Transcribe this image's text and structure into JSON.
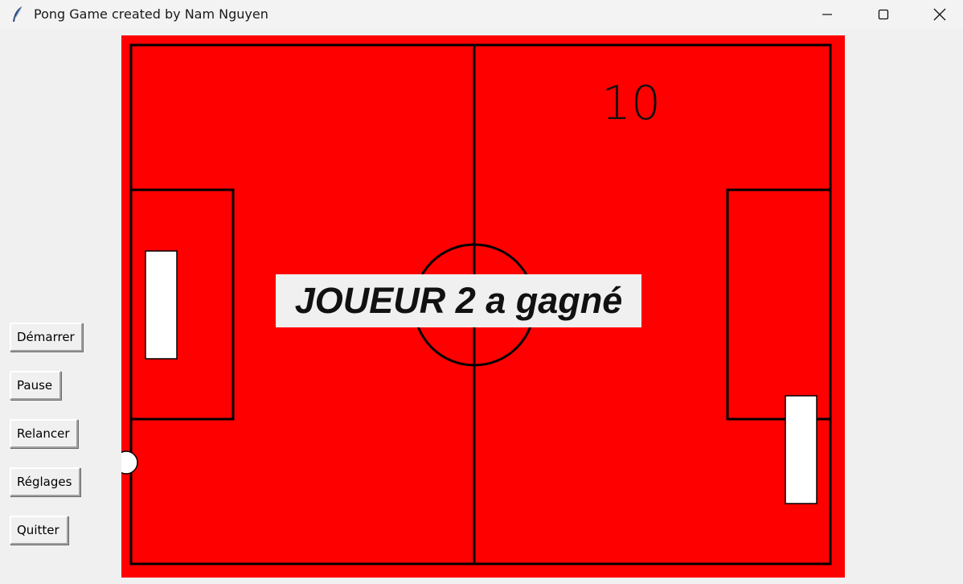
{
  "window": {
    "title": "Pong Game created by Nam Nguyen",
    "app_icon": "feather-icon",
    "controls": [
      "minimize-icon",
      "maximize-icon",
      "close-icon"
    ]
  },
  "sidebar": {
    "buttons": [
      {
        "label": "Démarrer"
      },
      {
        "label": "Pause"
      },
      {
        "label": "Relancer"
      },
      {
        "label": "Réglages"
      },
      {
        "label": "Quitter"
      }
    ]
  },
  "game": {
    "field_color": "#ff0000",
    "line_color": "#000000",
    "score": "10",
    "winner_message": "JOUEUR 2 a gagné"
  }
}
